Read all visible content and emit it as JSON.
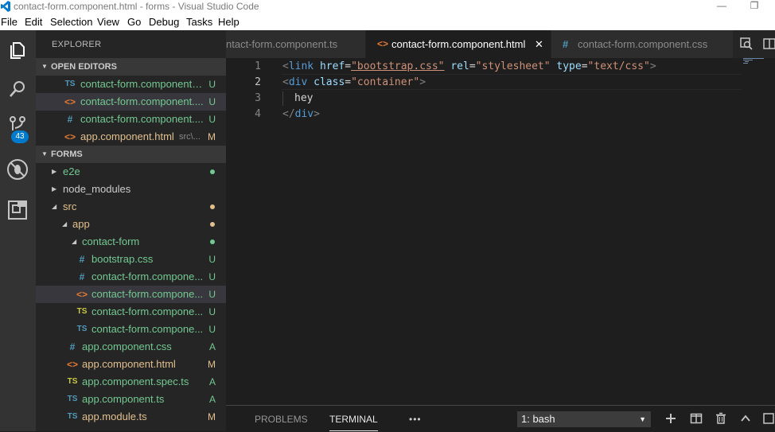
{
  "window": {
    "title": "contact-form.component.html - forms - Visual Studio Code"
  },
  "menu": [
    "File",
    "Edit",
    "Selection",
    "View",
    "Go",
    "Debug",
    "Tasks",
    "Help"
  ],
  "activity_bar": {
    "scm_badge": "43",
    "icons": [
      "explorer-icon",
      "search-icon",
      "source-control-icon",
      "debug-icon",
      "extensions-icon"
    ]
  },
  "sidebar": {
    "title": "EXPLORER",
    "open_editors": {
      "header": "OPEN EDITORS",
      "items": [
        {
          "icon": "TS",
          "name": "contact-form.component.t...",
          "path": "",
          "status": "U"
        },
        {
          "icon": "<>",
          "name": "contact-form.component....",
          "path": "",
          "status": "U"
        },
        {
          "icon": "#",
          "name": "contact-form.component....",
          "path": "",
          "status": "U"
        },
        {
          "icon": "<>",
          "name": "app.component.html",
          "path": "src\\...",
          "status": "M"
        }
      ]
    },
    "project": {
      "header": "FORMS",
      "items": [
        {
          "type": "folder",
          "name": "e2e",
          "collapsed": true
        },
        {
          "type": "folder",
          "name": "node_modules",
          "collapsed": true
        },
        {
          "type": "folder",
          "name": "src",
          "collapsed": false
        },
        {
          "type": "folder",
          "name": "app",
          "collapsed": false
        },
        {
          "type": "folder",
          "name": "contact-form",
          "collapsed": false
        },
        {
          "type": "file",
          "icon": "#",
          "name": "bootstrap.css",
          "status": "U"
        },
        {
          "type": "file",
          "icon": "#",
          "name": "contact-form.compone...",
          "status": "U"
        },
        {
          "type": "file",
          "icon": "<>",
          "name": "contact-form.compone...",
          "status": "U"
        },
        {
          "type": "file",
          "icon": "TS",
          "name": "contact-form.compone...",
          "status": "U"
        },
        {
          "type": "file",
          "icon": "TS",
          "name": "contact-form.compone...",
          "status": "U"
        },
        {
          "type": "file",
          "icon": "#",
          "name": "app.component.css",
          "status": "A"
        },
        {
          "type": "file",
          "icon": "<>",
          "name": "app.component.html",
          "status": "M"
        },
        {
          "type": "file",
          "icon": "TS",
          "name": "app.component.spec.ts",
          "status": "A"
        },
        {
          "type": "file",
          "icon": "TS",
          "name": "app.component.ts",
          "status": "A"
        },
        {
          "type": "file",
          "icon": "TS",
          "name": "app.module.ts",
          "status": "M"
        }
      ]
    }
  },
  "tabs": [
    {
      "name": "ntact-form.component.ts",
      "icon": "",
      "active": false
    },
    {
      "name": "contact-form.component.html",
      "icon": "<>",
      "active": true
    },
    {
      "name": "contact-form.component.css",
      "icon": "#",
      "active": false
    }
  ],
  "editor": {
    "line_numbers": [
      "1",
      "2",
      "3",
      "4"
    ],
    "current_line": 2,
    "lines": [
      {
        "tag_open": "<",
        "tag": "link",
        "a1": "href",
        "v1": "\"bootstrap.css\"",
        "a2": "rel",
        "v2": "\"stylesheet\"",
        "a3": "type",
        "v3": "\"text/css\"",
        "tag_close": ">"
      },
      {
        "tag_open": "<",
        "tag": "div",
        "a1": "class",
        "v1": "\"container\"",
        "tag_close": ">"
      },
      {
        "text": "hey"
      },
      {
        "tag_open": "</",
        "tag": "div",
        "tag_close": ">"
      }
    ]
  },
  "panel": {
    "tabs": [
      "PROBLEMS",
      "TERMINAL"
    ],
    "active_tab": "TERMINAL",
    "more": "•••",
    "terminal_select": "1: bash"
  },
  "colors": {
    "html_icon": "#e37933",
    "ts_icon": "#519aba",
    "untracked": "#73c991",
    "modified": "#e2c08d",
    "badge": "#007acc"
  }
}
